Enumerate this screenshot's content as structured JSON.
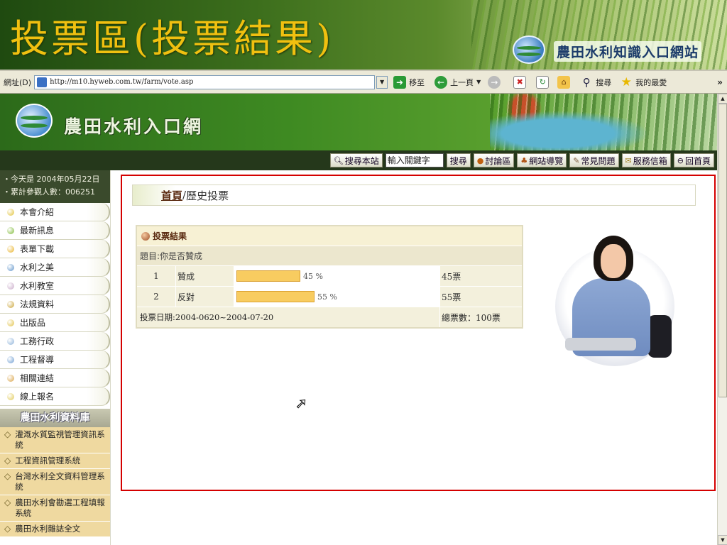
{
  "slide": {
    "title": "投票區(投票結果)",
    "site_name": "農田水利知識入口網站"
  },
  "toolbar": {
    "address_label": "網址(D)",
    "url": "http://m10.hyweb.com.tw/farm/vote.asp",
    "go_label": "移至",
    "back_label": "上一頁",
    "search_label": "搜尋",
    "favorites_label": "我的最愛",
    "more": "»"
  },
  "header": {
    "site_title": "農田水利入口網"
  },
  "nav": {
    "search_site": "搜尋本站",
    "keyword_value": "輸入關鍵字",
    "search_btn": "搜尋",
    "forum": "討論區",
    "site_guide": "網站導覽",
    "faq": "常見問題",
    "mailbox": "服務信箱",
    "home": "回首頁"
  },
  "sidebar": {
    "today_text": "・今天是 2004年05月22日",
    "visitors_text": "・累計參觀人數：006251",
    "menu": [
      {
        "label": "本會介紹",
        "color": "#e0c030"
      },
      {
        "label": "最新訊息",
        "color": "#7ab830"
      },
      {
        "label": "表單下載",
        "color": "#e8b020"
      },
      {
        "label": "水利之美",
        "color": "#5a90c8"
      },
      {
        "label": "水利教室",
        "color": "#c8a8c8"
      },
      {
        "label": "法規資料",
        "color": "#c8a030"
      },
      {
        "label": "出版品",
        "color": "#e0c040"
      },
      {
        "label": "工務行政",
        "color": "#8ab0d8"
      },
      {
        "label": "工程督導",
        "color": "#6a9ad0"
      },
      {
        "label": "相關連結",
        "color": "#d8a040"
      },
      {
        "label": "線上報名",
        "color": "#e0c850"
      }
    ],
    "db_header": "農田水利資料庫",
    "db_items": [
      "灌溉水質監視管理資訊系統",
      "工程資訊管理系統",
      "台灣水利全文資料管理系統",
      "農田水利會勘選工程填報系統",
      "農田水利雜誌全文"
    ]
  },
  "main": {
    "breadcrumb_home": "首頁",
    "breadcrumb_sep": "/",
    "breadcrumb_current": "歷史投票",
    "result_title": "投票結果",
    "question": "題目:你是否贊成",
    "rows": [
      {
        "no": "1",
        "label": "贊成",
        "percent_text": "45 %",
        "percent": 45,
        "votes": "45票"
      },
      {
        "no": "2",
        "label": "反對",
        "percent_text": "55 %",
        "percent": 55,
        "votes": "55票"
      }
    ],
    "vote_date": "投票日期:2004-0620~2004-07-20",
    "total_votes": "總票數：100票"
  }
}
